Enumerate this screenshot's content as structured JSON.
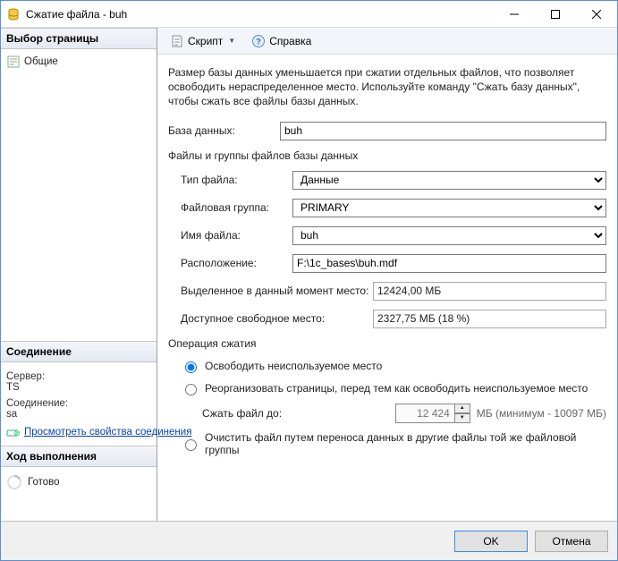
{
  "title": "Сжатие файла - buh",
  "sidebar": {
    "page_select_header": "Выбор страницы",
    "tree": {
      "item0": "Общие"
    },
    "connection_header": "Соединение",
    "server_label": "Сервер:",
    "server_value": "TS",
    "conn_label": "Соединение:",
    "conn_value": "sa",
    "view_props_link": "Просмотреть свойства соединения",
    "progress_header": "Ход выполнения",
    "status": "Готово"
  },
  "toolbar": {
    "script": "Скрипт",
    "help": "Справка"
  },
  "main": {
    "desc": "Размер базы данных уменьшается при сжатии отдельных файлов, что позволяет освободить нераспределенное место. Используйте команду \"Сжать базу данных\", чтобы сжать все файлы базы данных.",
    "db_label": "База данных:",
    "db_value": "buh",
    "files_header": "Файлы и группы файлов базы данных",
    "file_type_label": "Тип файла:",
    "file_type_value": "Данные",
    "filegroup_label": "Файловая группа:",
    "filegroup_value": "PRIMARY",
    "filename_label": "Имя файла:",
    "filename_value": "buh",
    "location_label": "Расположение:",
    "location_value": "F:\\1c_bases\\buh.mdf",
    "allocated_label": "Выделенное в данный момент место:",
    "allocated_value": "12424,00 МБ",
    "free_label": "Доступное свободное место:",
    "free_value": "2327,75 МБ (18 %)",
    "shrink_header": "Операция сжатия",
    "opt1": "Освободить неиспользуемое место",
    "opt2": "Реорганизовать страницы, перед тем как освободить неиспользуемое место",
    "shrink_to_label": "Сжать файл до:",
    "shrink_to_value": "12 424",
    "shrink_to_suffix": "МБ (минимум - 10097 МБ)",
    "opt3": "Очистить файл путем переноса данных в другие файлы той же файловой группы"
  },
  "footer": {
    "ok": "OK",
    "cancel": "Отмена"
  }
}
